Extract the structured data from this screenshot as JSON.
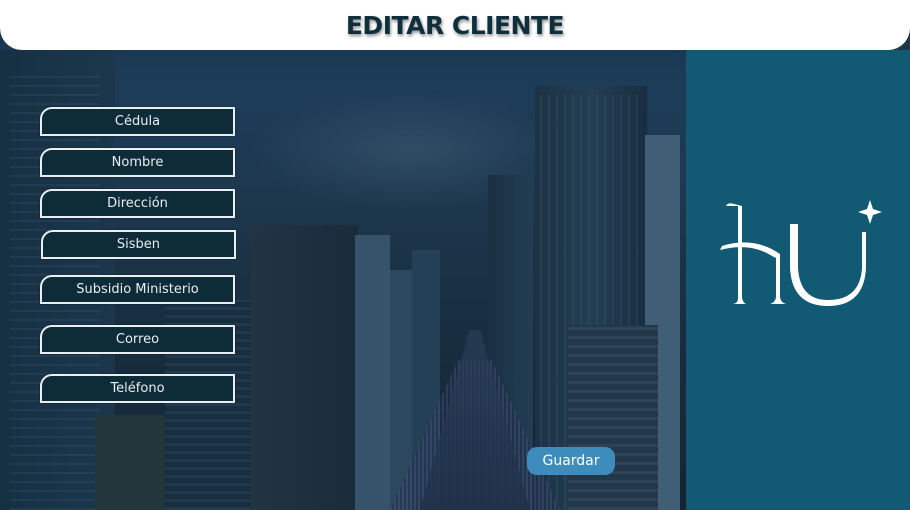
{
  "header": {
    "title": "EDITAR CLIENTE"
  },
  "form": {
    "fields": [
      {
        "label": "Cédula"
      },
      {
        "label": "Nombre"
      },
      {
        "label": "Dirección"
      },
      {
        "label": "Sisben"
      },
      {
        "label": "Subsidio Ministerio"
      },
      {
        "label": "Correo"
      },
      {
        "label": "Teléfono"
      }
    ],
    "save_label": "Guardar"
  },
  "logo": {
    "icon": "hu-monogram-logo"
  },
  "colors": {
    "header_bg": "#ffffff",
    "title": "#0f2f3c",
    "right_panel": "#125a74",
    "field_bg": "#0e2b38",
    "save_button": "#3d8cbc"
  }
}
